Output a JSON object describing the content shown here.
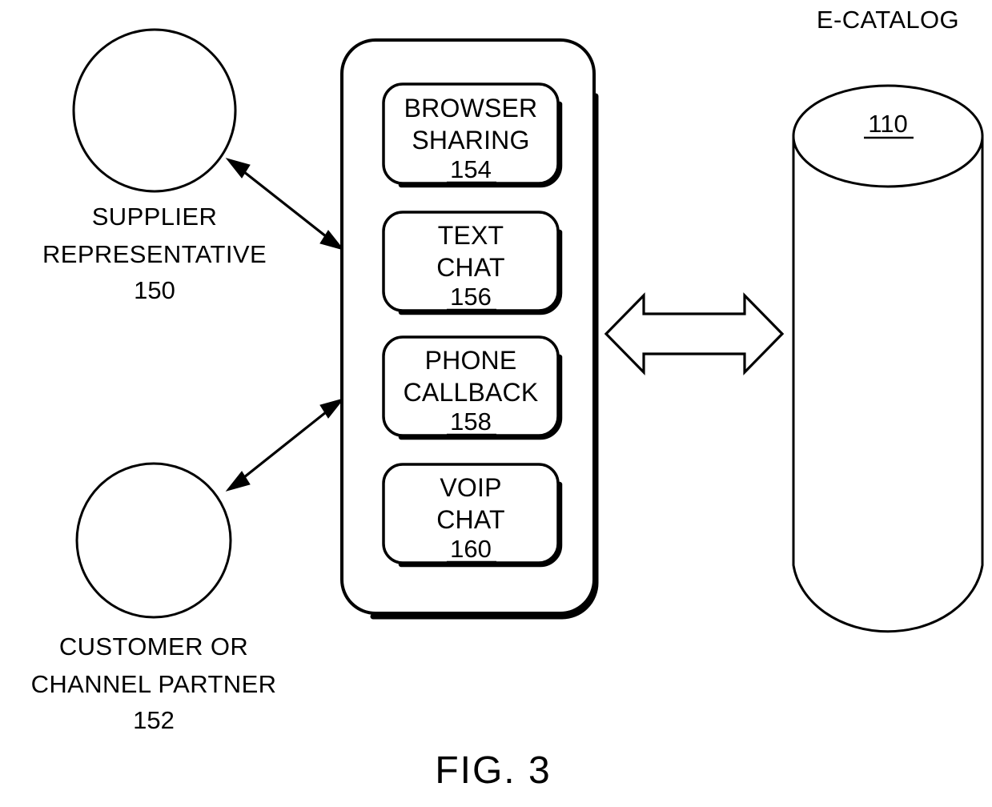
{
  "figure": {
    "caption": "FIG. 3",
    "background_color": "#ffffff",
    "line_color": "#000000"
  },
  "actors": [
    {
      "id": "supplier-representative",
      "shape": "circle",
      "label_lines": [
        "SUPPLIER",
        "REPRESENTATIVE"
      ],
      "reference_number": "150",
      "reference_underlined": false
    },
    {
      "id": "customer-or-channel-partner",
      "shape": "circle",
      "label_lines": [
        "CUSTOMER OR",
        "CHANNEL PARTNER"
      ],
      "reference_number": "152",
      "reference_underlined": false
    }
  ],
  "communication_panel": {
    "id": "communication-channels-panel",
    "shape": "rounded-rectangle",
    "modules": [
      {
        "id": "browser-sharing",
        "label_lines": [
          "BROWSER",
          "SHARING"
        ],
        "reference_number": "154",
        "reference_underlined": true
      },
      {
        "id": "text-chat",
        "label_lines": [
          "TEXT",
          "CHAT"
        ],
        "reference_number": "156",
        "reference_underlined": true
      },
      {
        "id": "phone-callback",
        "label_lines": [
          "PHONE",
          "CALLBACK"
        ],
        "reference_number": "158",
        "reference_underlined": true
      },
      {
        "id": "voip-chat",
        "label_lines": [
          "VOIP",
          "CHAT"
        ],
        "reference_number": "160",
        "reference_underlined": true
      }
    ]
  },
  "datastore": {
    "id": "e-catalog",
    "shape": "cylinder",
    "title": "E-CATALOG",
    "reference_number": "110",
    "reference_underlined": true
  },
  "connectors": [
    {
      "id": "supplier-to-panel",
      "style": "double-headed-thin-arrow",
      "from": "supplier-representative",
      "to": "communication-channels-panel"
    },
    {
      "id": "customer-to-panel",
      "style": "double-headed-thin-arrow",
      "from": "customer-or-channel-partner",
      "to": "communication-channels-panel"
    },
    {
      "id": "panel-to-catalog",
      "style": "hollow-double-block-arrow",
      "from": "communication-channels-panel",
      "to": "e-catalog"
    }
  ]
}
